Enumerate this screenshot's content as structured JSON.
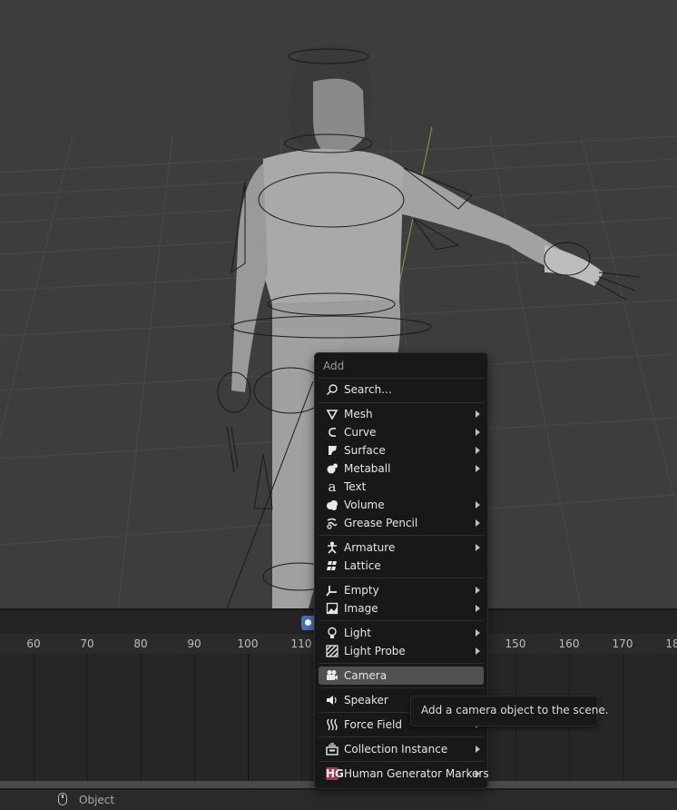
{
  "menu": {
    "title": "Add",
    "search": "Search...",
    "items": [
      {
        "label": "Mesh",
        "icon": "mesh-icon",
        "submenu": true
      },
      {
        "label": "Curve",
        "icon": "curve-icon",
        "submenu": true
      },
      {
        "label": "Surface",
        "icon": "surface-icon",
        "submenu": true
      },
      {
        "label": "Metaball",
        "icon": "metaball-icon",
        "submenu": true
      },
      {
        "label": "Text",
        "icon": "text-icon",
        "submenu": false
      },
      {
        "label": "Volume",
        "icon": "volume-icon",
        "submenu": true
      },
      {
        "label": "Grease Pencil",
        "icon": "grease-pencil-icon",
        "submenu": true
      },
      {
        "label": "Armature",
        "icon": "armature-icon",
        "submenu": true
      },
      {
        "label": "Lattice",
        "icon": "lattice-icon",
        "submenu": false
      },
      {
        "label": "Empty",
        "icon": "empty-icon",
        "submenu": true
      },
      {
        "label": "Image",
        "icon": "image-icon",
        "submenu": true
      },
      {
        "label": "Light",
        "icon": "light-icon",
        "submenu": true
      },
      {
        "label": "Light Probe",
        "icon": "light-probe-icon",
        "submenu": true
      },
      {
        "label": "Camera",
        "icon": "camera-icon",
        "submenu": false,
        "active": true
      },
      {
        "label": "Speaker",
        "icon": "speaker-icon",
        "submenu": false
      },
      {
        "label": "Force Field",
        "icon": "force-field-icon",
        "submenu": true
      },
      {
        "label": "Collection Instance",
        "icon": "collection-instance-icon",
        "submenu": true
      },
      {
        "label": "Human Generator Markers",
        "icon": "hg-icon",
        "icon_text": "HG",
        "submenu": true
      }
    ]
  },
  "tooltip": "Add a camera object to the scene.",
  "timeline": {
    "ticks": [
      "60",
      "70",
      "80",
      "90",
      "100",
      "110",
      "150",
      "160",
      "170",
      "18"
    ]
  },
  "statusbar": {
    "label": "Object"
  },
  "colors": {
    "accent": "#4772b3",
    "menu_bg": "#181818",
    "highlight": "#505050",
    "hg_badge": "#9b3b61"
  }
}
